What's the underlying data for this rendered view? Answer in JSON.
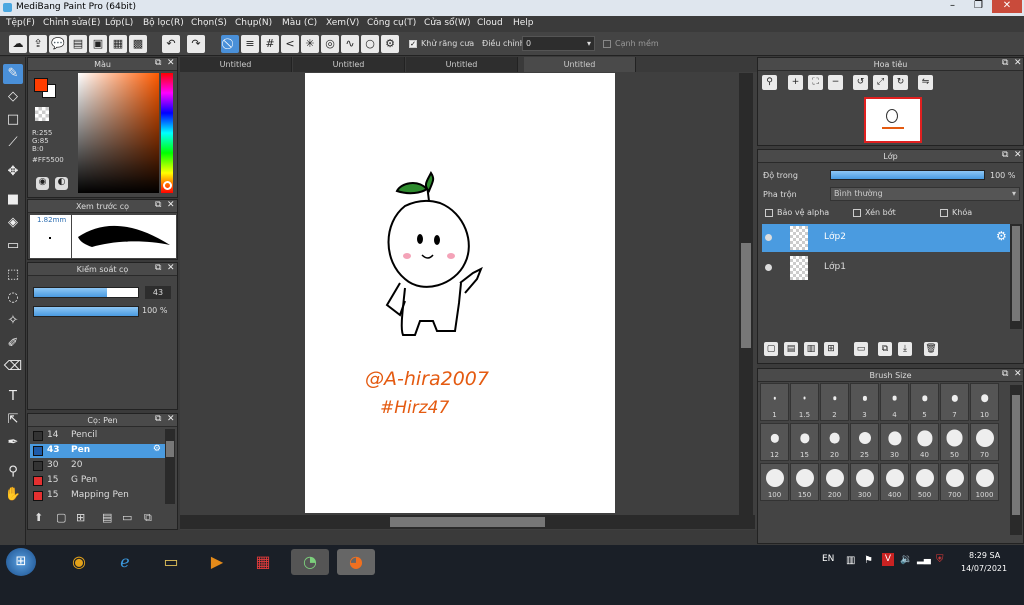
{
  "title_bar": {
    "title": "MediBang Paint Pro (64bit)"
  },
  "menu": [
    "Tệp(F)",
    "Chỉnh sửa(E)",
    "Lớp(L)",
    "Bộ lọc(R)",
    "Chọn(S)",
    "Chụp(N)",
    "Màu (C)",
    "Xem(V)",
    "Công cụ(T)",
    "Cửa sổ(W)",
    "Cloud",
    "Help"
  ],
  "toolbar": {
    "antialias_label": "Khử răng cưa",
    "adjust_label": "Điều chỉnh",
    "adjust_value": "0",
    "edge_label": "Cạnh mềm"
  },
  "tabs": [
    "Untitled",
    "Untitled",
    "Untitled",
    "Untitled"
  ],
  "color_panel": {
    "title": "Màu",
    "r": "R:255",
    "g": "G:85",
    "b": "B:0",
    "hex": "#FF5500",
    "primary": "#ff3d00",
    "secondary": "#ffffff"
  },
  "brush_preview": {
    "title": "Xem trước cọ",
    "size": "1.82mm"
  },
  "brush_control": {
    "title": "Kiểm soát cọ",
    "size": "43",
    "opacity": "100 %",
    "size_fill": 0.7,
    "opacity_fill": 1.0
  },
  "brush_list": {
    "title": "Cọ: Pen",
    "items": [
      {
        "size": "14",
        "name": "Pencil",
        "color": "#333333",
        "selected": false
      },
      {
        "size": "43",
        "name": "Pen",
        "color": "#1d5aa8",
        "selected": true
      },
      {
        "size": "30",
        "name": "20",
        "color": "#333333",
        "selected": false
      },
      {
        "size": "15",
        "name": "G Pen",
        "color": "#e53030",
        "selected": false
      },
      {
        "size": "15",
        "name": "Mapping Pen",
        "color": "#e53030",
        "selected": false
      }
    ]
  },
  "navigator": {
    "title": "Hoa tiêu"
  },
  "layers": {
    "title": "Lớp",
    "opacity_label": "Độ trong",
    "opacity_value": "100 %",
    "blend_label": "Pha trộn",
    "blend_value": "Bình thường",
    "protect_alpha": "Bảo vệ alpha",
    "clipping": "Xén bớt",
    "lock": "Khóa",
    "items": [
      {
        "name": "Lớp2",
        "selected": true
      },
      {
        "name": "Lớp1",
        "selected": false
      }
    ]
  },
  "brush_size": {
    "title": "Brush Size",
    "sizes": [
      "1",
      "1.5",
      "2",
      "3",
      "4",
      "5",
      "7",
      "10",
      "12",
      "15",
      "20",
      "25",
      "30",
      "40",
      "50",
      "70",
      "100",
      "150",
      "200",
      "300",
      "400",
      "500",
      "700",
      "1000"
    ]
  },
  "canvas": {
    "signature_line1": "@A-hira2007",
    "signature_line2": "#Hirz47"
  },
  "taskbar": {
    "lang": "EN",
    "time": "8:29 SA",
    "date": "14/07/2021"
  }
}
